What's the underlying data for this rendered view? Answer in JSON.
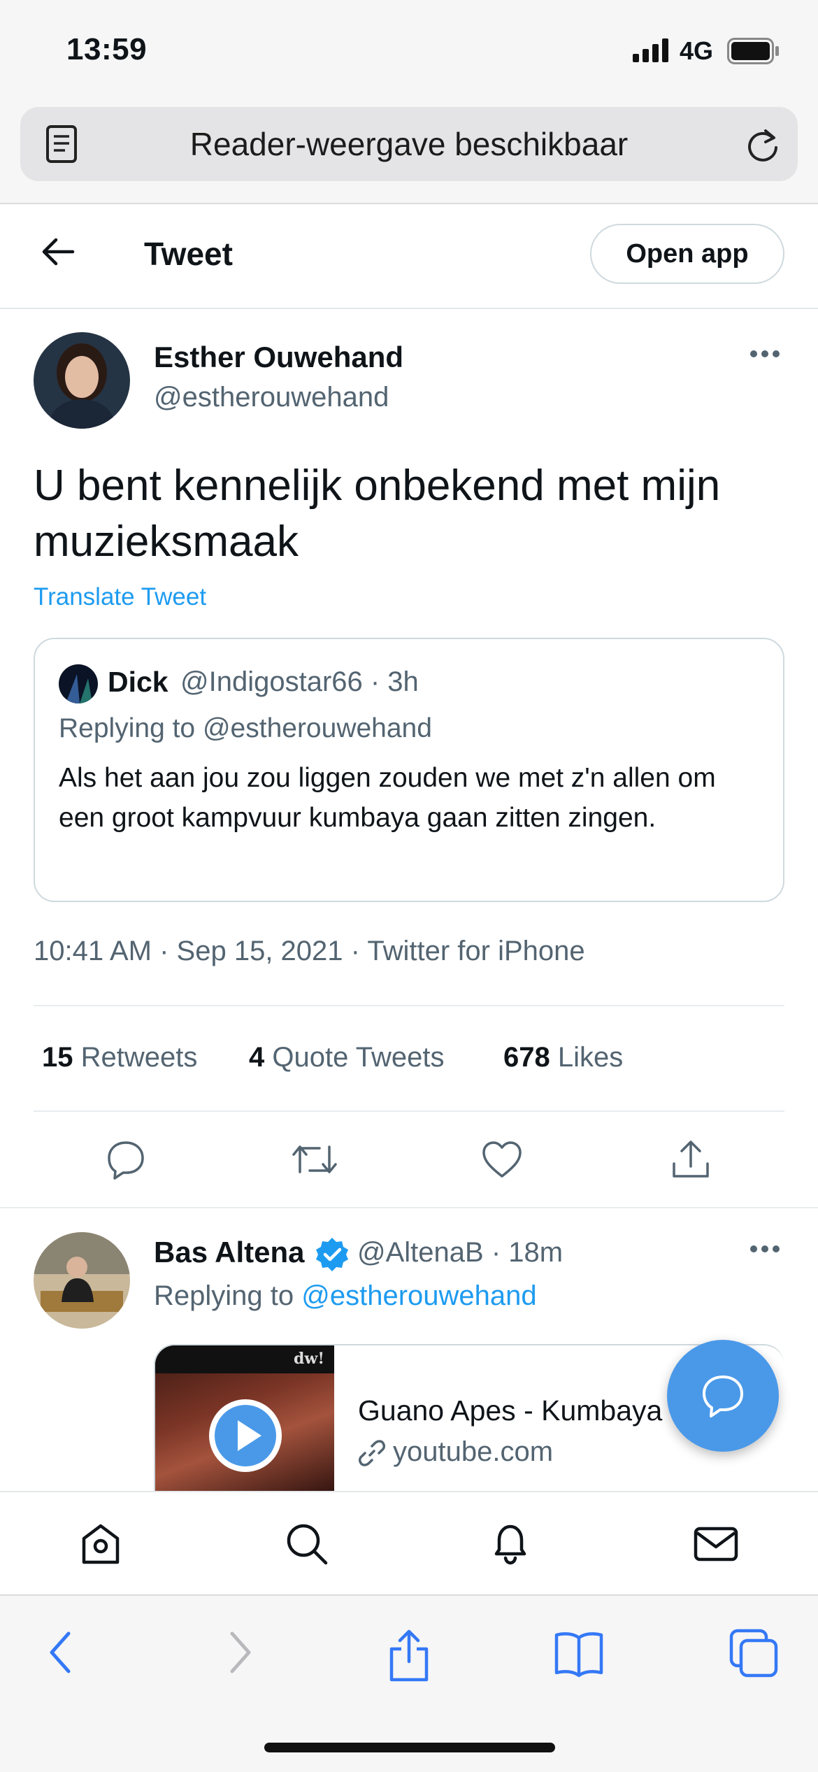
{
  "status_bar": {
    "time": "13:59",
    "network": "4G"
  },
  "safari": {
    "url_bar_text": "Reader-weergave beschikbaar"
  },
  "header": {
    "title": "Tweet",
    "open_app_label": "Open app"
  },
  "tweet": {
    "author_name": "Esther Ouwehand",
    "author_handle": "@estherouwehand",
    "text": "U bent kennelijk onbekend met mijn muzieksmaak",
    "translate_label": "Translate Tweet",
    "quoted": {
      "author_name": "Dick",
      "handle_time": "@Indigostar66 · 3h",
      "replying_to": "Replying to @estherouwehand",
      "text": "Als het aan jou zou liggen zouden we met z'n allen om een groot kampvuur kumbaya gaan zitten zingen."
    },
    "timestamp": "10:41 AM · Sep 15, 2021 · Twitter for iPhone",
    "stats": {
      "retweets_count": "15",
      "retweets_label": "Retweets",
      "quotes_count": "4",
      "quotes_label": "Quote Tweets",
      "likes_count": "678",
      "likes_label": "Likes"
    }
  },
  "reply": {
    "author_name": "Bas Altena",
    "handle_time": "@AltenaB · 18m",
    "replying_prefix": "Replying to",
    "replying_handle": "@estherouwehand",
    "link_card": {
      "thumb_brand": "dw!",
      "title": "Guano Apes - Kumbaya",
      "domain": "youtube.com"
    }
  },
  "icons": {
    "reader": "reader-icon",
    "reload": "reload-icon",
    "back": "back-arrow-icon",
    "more": "more-icon",
    "reply": "reply-icon",
    "retweet": "retweet-icon",
    "like": "heart-icon",
    "share": "share-icon",
    "verified": "verified-badge-icon",
    "compose": "compose-reply-icon",
    "home": "home-icon",
    "search": "search-icon",
    "notifications": "bell-icon",
    "messages": "mail-icon"
  },
  "colors": {
    "accent": "#1d9bf0",
    "fab": "#4a99e9",
    "safari_blue": "#3478f6",
    "secondary_text": "#536471"
  }
}
